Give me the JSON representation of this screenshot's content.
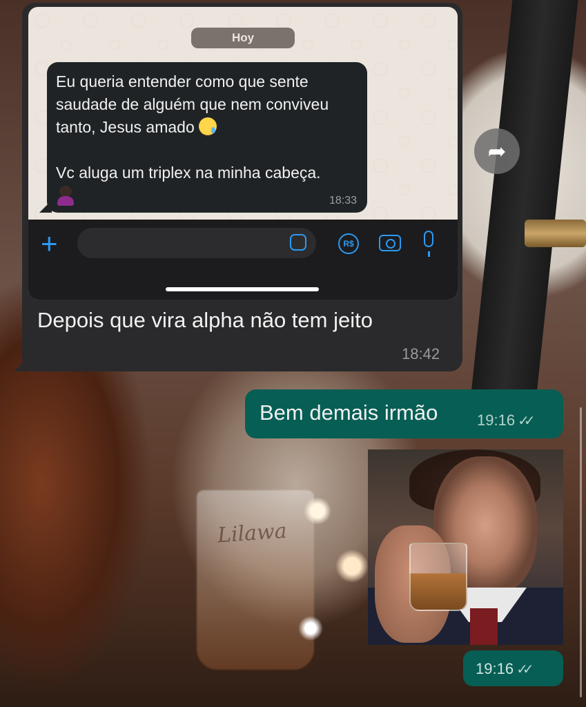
{
  "quoted_message": {
    "embedded_screenshot": {
      "date_label": "Hoy",
      "message_line1": "Eu queria entender como que sente saudade de alguém que nem conviveu tanto, Jesus amado",
      "message_line2": "Vc aluga um triplex na minha cabeça.",
      "time": "18:33",
      "currency_icon_label": "R$"
    },
    "text": "Depois que vira alpha não tem jeito",
    "time": "18:42"
  },
  "outgoing": [
    {
      "text": "Bem demais irmão",
      "time": "19:16",
      "status": "read"
    },
    {
      "type": "image",
      "time": "19:16",
      "status": "read"
    }
  ],
  "icons": {
    "forward": "forward-arrow-icon",
    "read_receipt": "double-check-icon"
  },
  "colors": {
    "outgoing_bubble": "#075e54",
    "incoming_bubble": "#2a2a2c",
    "accent_blue": "#2c9af2"
  }
}
